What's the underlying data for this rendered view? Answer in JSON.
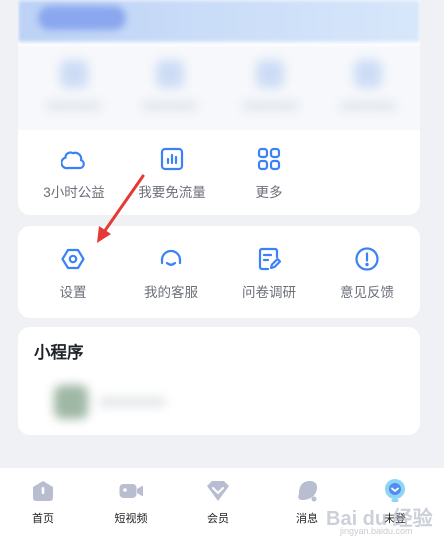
{
  "tools": [
    {
      "label": "3小时公益",
      "icon": "cloud-icon"
    },
    {
      "label": "我要免流量",
      "icon": "bar-chart-icon"
    },
    {
      "label": "更多",
      "icon": "grid-more-icon"
    }
  ],
  "services": [
    {
      "label": "设置",
      "icon": "settings-hexagon-icon"
    },
    {
      "label": "我的客服",
      "icon": "headset-icon"
    },
    {
      "label": "问卷调研",
      "icon": "survey-edit-icon"
    },
    {
      "label": "意见反馈",
      "icon": "exclamation-icon"
    }
  ],
  "mini_programs": {
    "title": "小程序"
  },
  "tabbar": [
    {
      "label": "首页",
      "icon": "home-icon"
    },
    {
      "label": "短视频",
      "icon": "video-camera-icon"
    },
    {
      "label": "会员",
      "icon": "diamond-icon"
    },
    {
      "label": "消息",
      "icon": "message-bell-icon"
    },
    {
      "label": "未登",
      "icon": "profile-bulb-icon"
    }
  ],
  "watermark": {
    "logo": "Bai du 经验",
    "url": "jingyan.baidu.com"
  },
  "colors": {
    "accent": "#3b82f6",
    "arrow": "#e53935",
    "text_muted": "#6b6f78"
  }
}
